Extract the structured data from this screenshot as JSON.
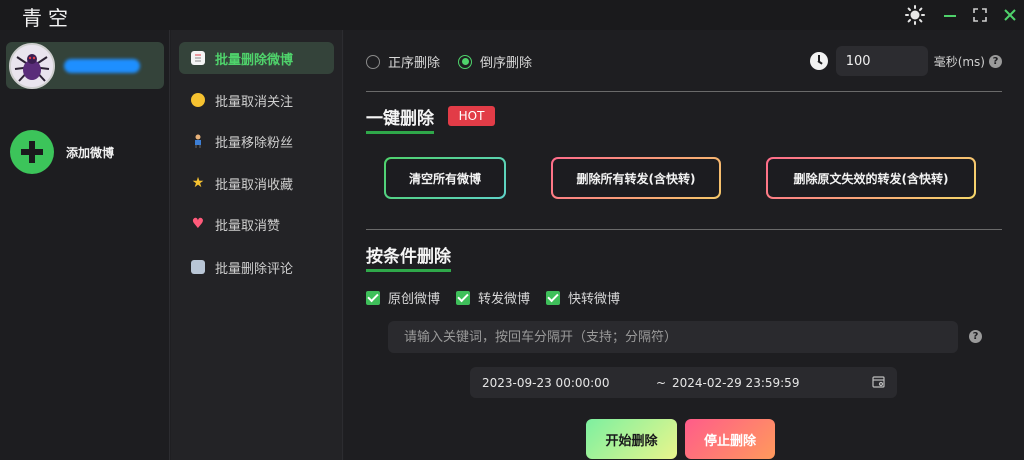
{
  "app": {
    "title": "青空"
  },
  "accounts": {
    "add_label": "添加微博"
  },
  "nav": {
    "items": [
      {
        "label": "批量删除微博",
        "icon": "document-icon"
      },
      {
        "label": "批量取消关注",
        "icon": "lightbulb-icon"
      },
      {
        "label": "批量移除粉丝",
        "icon": "person-icon"
      },
      {
        "label": "批量取消收藏",
        "icon": "star-icon"
      },
      {
        "label": "批量取消赞",
        "icon": "heart-icon"
      },
      {
        "label": "批量删除评论",
        "icon": "comment-icon"
      }
    ]
  },
  "order": {
    "forward": "正序删除",
    "reverse": "倒序删除",
    "selected": "倒序删除"
  },
  "interval": {
    "value": "100",
    "unit": "毫秒(ms)"
  },
  "quick_delete": {
    "title": "一键删除",
    "badge": "HOT",
    "buttons": [
      "清空所有微博",
      "删除所有转发(含快转)",
      "删除原文失效的转发(含快转)"
    ]
  },
  "conditional": {
    "title": "按条件删除",
    "checks": [
      "原创微博",
      "转发微博",
      "快转微博"
    ],
    "keyword_placeholder": "请输入关键词，按回车分隔开（支持；分隔符）",
    "date_start": "2023-09-23 00:00:00",
    "date_sep": "~",
    "date_end": "2024-02-29 23:59:59"
  },
  "actions": {
    "start": "开始删除",
    "stop": "停止删除"
  },
  "colors": {
    "accent": "#4fd26b",
    "hot": "#e23c47",
    "nav_active_bg": "#34433a"
  }
}
